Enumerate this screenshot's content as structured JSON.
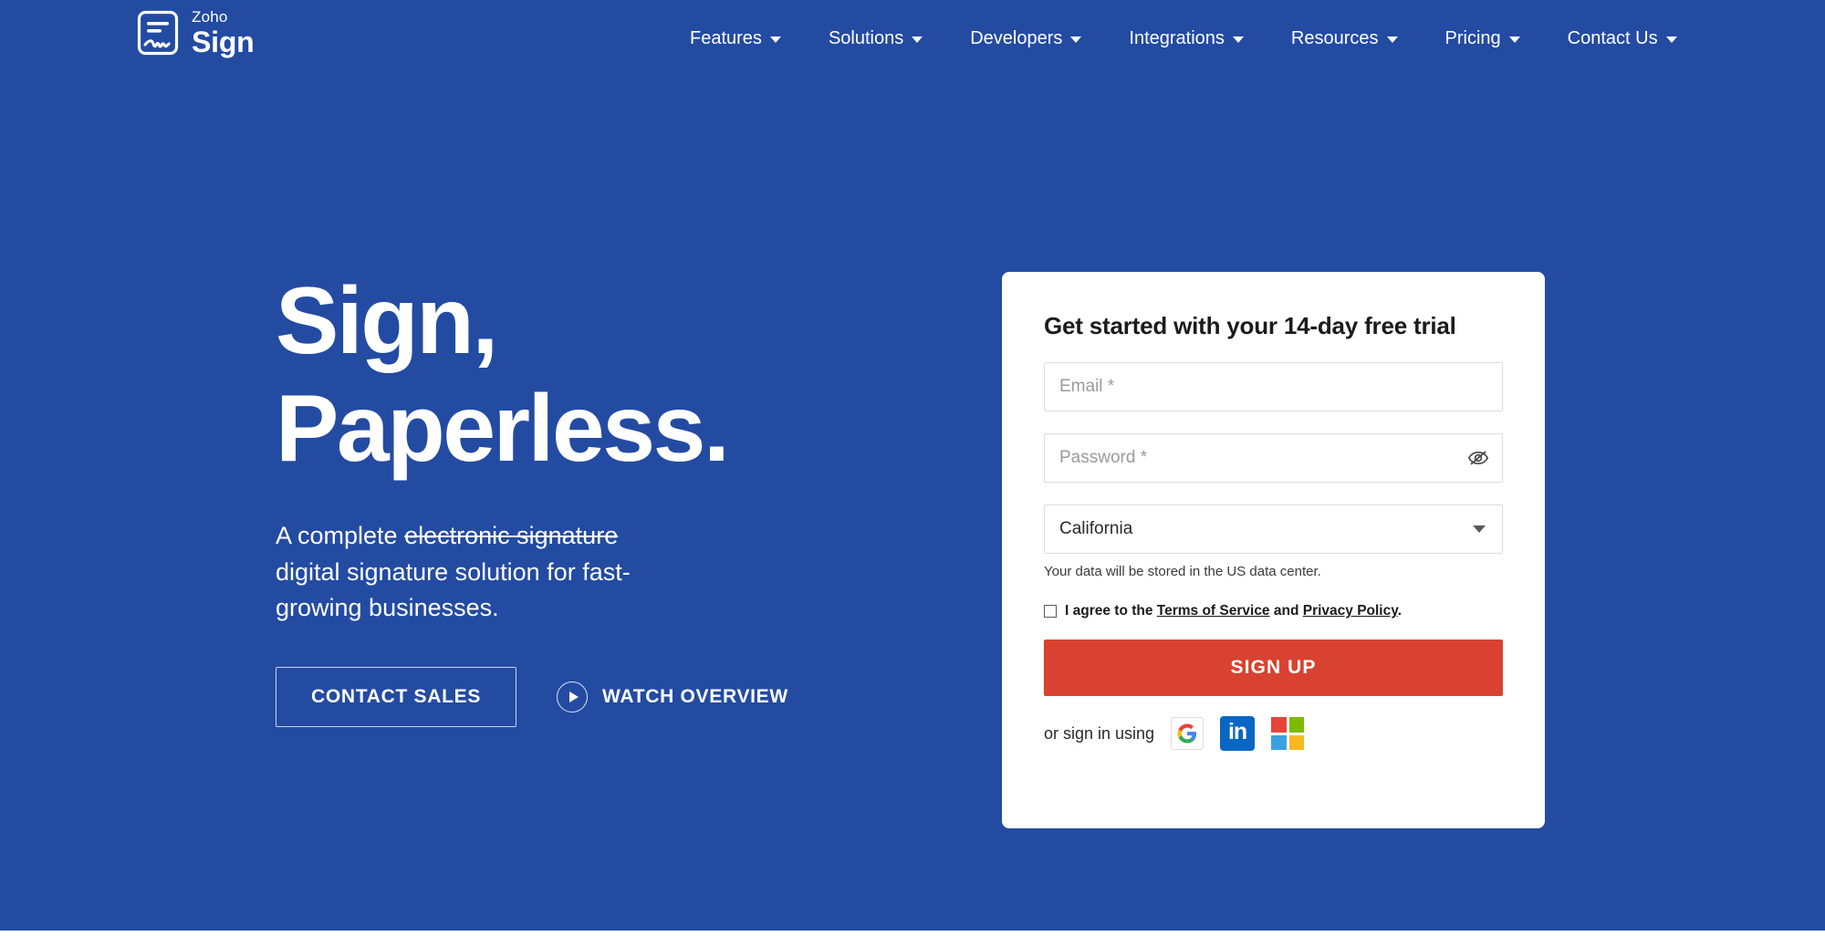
{
  "theme": {
    "background_blue": "#234ba2",
    "accent_red": "#d94230",
    "card_white": "#ffffff",
    "linkedin_blue": "#0a66c2"
  },
  "navbar": {
    "logo": {
      "icon": "document-signature-icon",
      "top_word": "Zoho",
      "bottom_word": "Sign"
    },
    "items": [
      {
        "label": "Features",
        "caret": "chevron-down-icon"
      },
      {
        "label": "Solutions",
        "caret": "chevron-down-icon"
      },
      {
        "label": "Developers",
        "caret": "chevron-down-icon"
      },
      {
        "label": "Integrations",
        "caret": "chevron-down-icon"
      },
      {
        "label": "Resources",
        "caret": "chevron-down-icon"
      },
      {
        "label": "Pricing",
        "caret": "chevron-down-icon"
      },
      {
        "label": "Contact Us",
        "caret": "chevron-down-icon"
      }
    ]
  },
  "hero": {
    "headline_line1": "Sign,",
    "headline_line2": "Paperless.",
    "sub_prefix": "A complete ",
    "sub_struck": "electronic signature",
    "sub_rest": " digital signature solution for fast-growing businesses.",
    "contact_sales_label": "CONTACT SALES",
    "watch_overview_label": "WATCH OVERVIEW",
    "play_icon": "play-circle-icon"
  },
  "signup": {
    "title": "Get started with your 14-day free trial",
    "email": {
      "value": "",
      "placeholder": "Email *"
    },
    "password": {
      "value": "",
      "placeholder": "Password *",
      "toggle_icon": "eye-slash-icon"
    },
    "datacenter": {
      "selected": "California",
      "caret": "chevron-down-icon",
      "note": "Your data will be stored in the US data center."
    },
    "agreement": {
      "checked": false,
      "prefix": "I agree to the ",
      "terms_label": "Terms of Service",
      "conjunction": " and ",
      "privacy_label": "Privacy Policy",
      "suffix": "."
    },
    "submit_label": "SIGN UP",
    "social": {
      "label": "or sign in using",
      "providers": [
        {
          "name": "google",
          "glyph": "G"
        },
        {
          "name": "linkedin",
          "glyph": "in"
        },
        {
          "name": "microsoft",
          "glyph": ""
        }
      ],
      "microsoft_colors": [
        "#e8443a",
        "#7cbb00",
        "#39a2e0",
        "#f9b81f"
      ]
    }
  }
}
